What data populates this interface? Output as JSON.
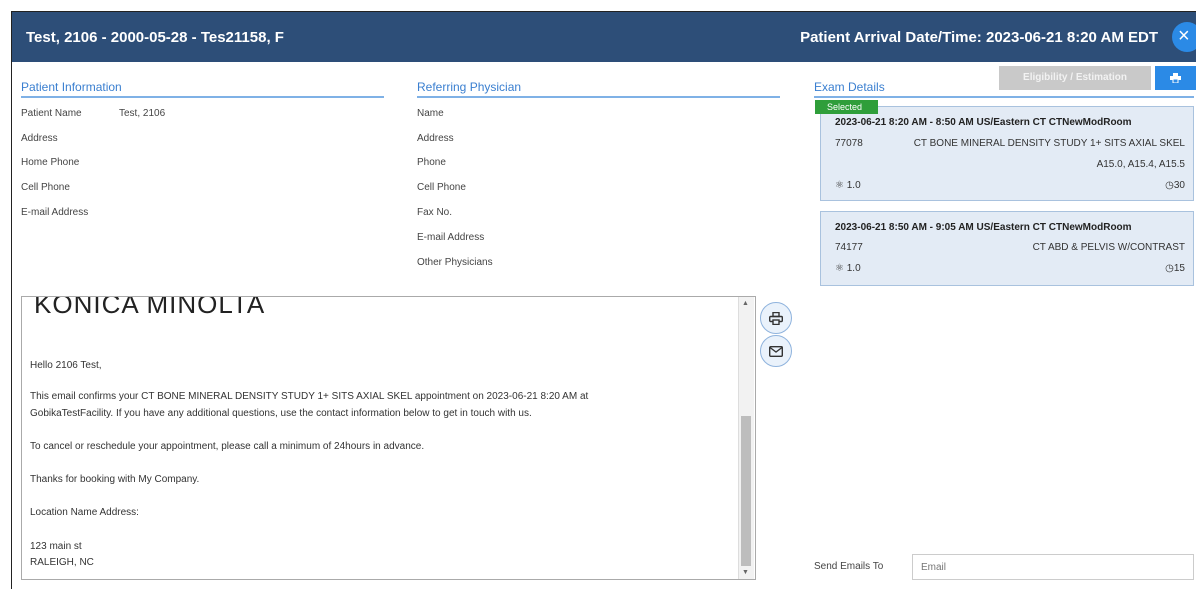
{
  "header": {
    "patient_title": "Test, 2106 - 2000-05-28 - Tes21158, F",
    "arrival": "Patient Arrival Date/Time: 2023-06-21 8:20 AM EDT",
    "close_icon": "×"
  },
  "patient_info": {
    "title": "Patient Information",
    "labels": [
      "Patient Name",
      "Address",
      "Home Phone",
      "Cell Phone",
      "E-mail Address"
    ],
    "patient_name_value": "Test, 2106"
  },
  "referring_physician": {
    "title": "Referring Physician",
    "labels": [
      "Name",
      "Address",
      "Phone",
      "Cell Phone",
      "Fax No.",
      "E-mail Address",
      "Other Physicians"
    ]
  },
  "exam_details": {
    "title": "Exam Details",
    "eligibility_label": "Eligibility / Estimation",
    "selected_label": "Selected",
    "exams": [
      {
        "datetime": "2023-06-21  8:20 AM - 8:50 AM US/Eastern  CT  CTNewModRoom",
        "code": "77078",
        "description": "CT BONE MINERAL DENSITY STUDY 1+ SITS AXIAL SKEL",
        "dx": "A15.0, A15.4, A15.5",
        "units": "1.0",
        "duration": "30"
      },
      {
        "datetime": "2023-06-21  8:50 AM - 9:05 AM US/Eastern  CT  CTNewModRoom",
        "code": "74177",
        "description": "CT ABD & PELVIS W/CONTRAST",
        "units": "1.0",
        "duration": "15"
      }
    ]
  },
  "email": {
    "logo": "KONICA MINOLTA",
    "greeting": "Hello 2106 Test,",
    "line1": "This email confirms your CT BONE MINERAL DENSITY STUDY 1+ SITS AXIAL SKEL appointment on 2023-06-21 8:20 AM at",
    "line2": "GobikaTestFacility. If you have any additional questions, use the contact information below to get in touch with us.",
    "line3": "To cancel or reschedule your appointment, please call a minimum of 24hours in advance.",
    "line4": "Thanks for booking with My Company.",
    "line5": "Location Name Address:",
    "line6": "123 main st",
    "line7": "RALEIGH, NC"
  },
  "send": {
    "label": "Send Emails To",
    "placeholder": "Email"
  },
  "icons": {
    "print": "print-icon",
    "mail": "mail-icon",
    "units": "modality-icon",
    "clock": "clock-icon"
  },
  "colors": {
    "header_bg": "#2d4e78",
    "accent": "#2b8ae6",
    "selected_badge": "#2f9e3a",
    "card_bg": "#e3ebf5"
  }
}
